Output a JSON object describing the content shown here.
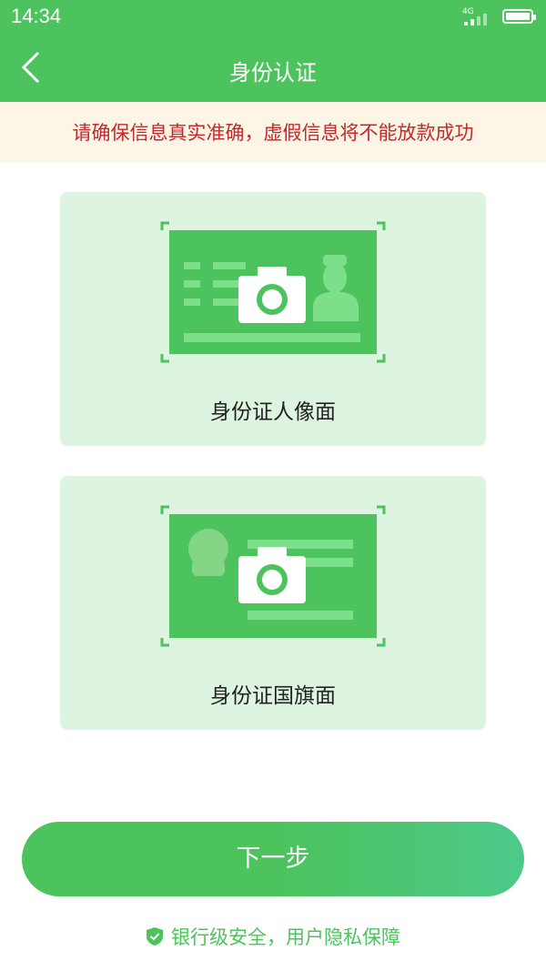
{
  "status_bar": {
    "time": "14:34",
    "network": "4G"
  },
  "nav": {
    "title": "身份认证",
    "back_icon": "chevron-left-icon"
  },
  "notice": {
    "text": "请确保信息真实准确，虚假信息将不能放款成功"
  },
  "cards": [
    {
      "label": "身份证人像面",
      "icon": "id-front-camera-icon"
    },
    {
      "label": "身份证国旗面",
      "icon": "id-back-camera-icon"
    }
  ],
  "next_button": {
    "label": "下一步"
  },
  "security": {
    "text": "银行级安全，用户隐私保障",
    "icon": "shield-check-icon"
  },
  "colors": {
    "brand": "#4cc35c",
    "notice_bg": "#fdf6e6",
    "notice_text": "#c8262b",
    "card_bg": "#ddf4e0"
  }
}
